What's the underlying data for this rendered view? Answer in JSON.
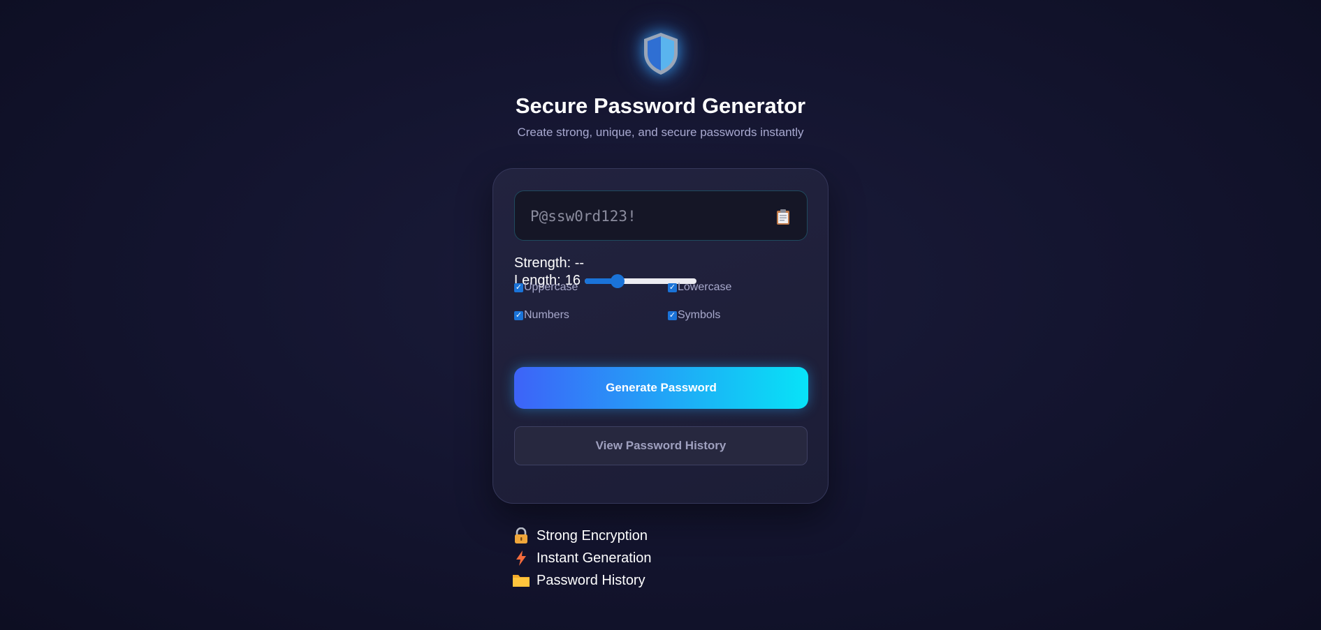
{
  "header": {
    "title": "Secure Password Generator",
    "subtitle": "Create strong, unique, and secure passwords instantly"
  },
  "generator": {
    "password_placeholder": "P@ssw0rd123!",
    "password_value": "",
    "copy_icon": "clipboard-icon",
    "strength_label": "Strength:",
    "strength_value": "--",
    "length_label": "Length:",
    "length_value": "16",
    "length_slider": {
      "value": 16,
      "min": 4,
      "max": 50
    },
    "options": [
      {
        "label": "Uppercase",
        "checked": true
      },
      {
        "label": "Lowercase",
        "checked": true
      },
      {
        "label": "Numbers",
        "checked": true
      },
      {
        "label": "Symbols",
        "checked": true
      }
    ],
    "generate_label": "Generate Password",
    "history_label": "View Password History"
  },
  "features": [
    {
      "icon": "lock-icon",
      "label": "Strong Encryption"
    },
    {
      "icon": "lightning-icon",
      "label": "Instant Generation"
    },
    {
      "icon": "folder-icon",
      "label": "Password History"
    }
  ],
  "colors": {
    "accent": "#1a73d8",
    "gradient_start": "#3d63f8",
    "gradient_end": "#08e3f8",
    "background": "#141530"
  }
}
